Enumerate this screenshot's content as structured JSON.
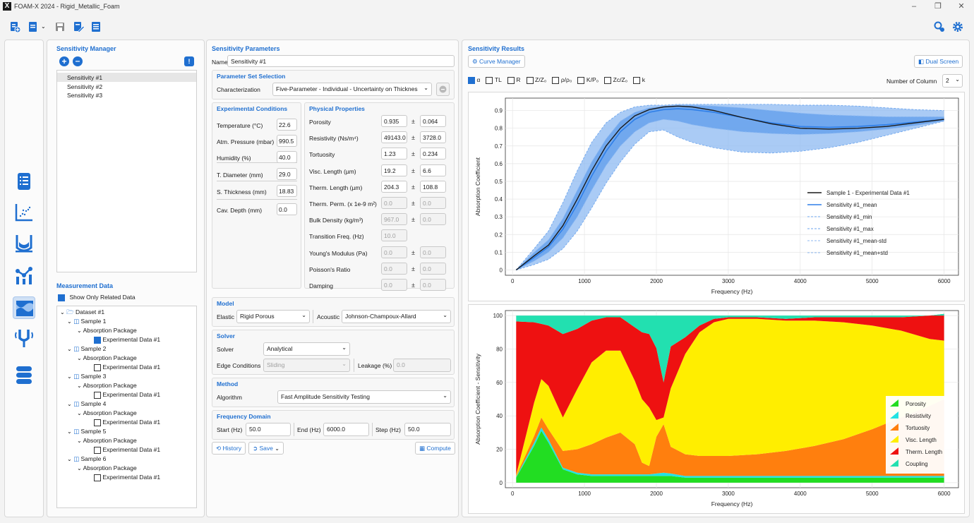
{
  "window": {
    "title": "FOAM-X 2024 - Rigid_Metallic_Foam",
    "logo": "X"
  },
  "sensitivity_manager": {
    "title": "Sensitivity Manager",
    "items": [
      "Sensitivity #1",
      "Sensitivity #2",
      "Sensitivity #3"
    ]
  },
  "measurement_data": {
    "title": "Measurement Data",
    "show_only_related": "Show Only Related Data",
    "dataset": "Dataset #1",
    "samples": [
      "Sample 1",
      "Sample 2",
      "Sample 3",
      "Sample 4",
      "Sample 5",
      "Sample 6"
    ],
    "package": "Absorption Package",
    "experimental": "Experimental Data #1"
  },
  "params": {
    "title": "Sensitivity Parameters",
    "name_label": "Name",
    "name_value": "Sensitivity #1",
    "param_set_title": "Parameter Set Selection",
    "characterization_label": "Characterization",
    "characterization_value": "Five-Parameter - Individual - Uncertainty on Thicknes",
    "exp_title": "Experimental Conditions",
    "exp": [
      {
        "label": "Temperature (°C)",
        "value": "22.6"
      },
      {
        "label": "Atm. Pressure (mbar)",
        "value": "990.5"
      },
      {
        "label": "Humidity (%)",
        "value": "40.0"
      },
      {
        "label": "T. Diameter (mm)",
        "value": "29.0"
      },
      {
        "label": "S. Thickness (mm)",
        "value": "18.83"
      },
      {
        "label": "Cav. Depth (mm)",
        "value": "0.0"
      }
    ],
    "phys_title": "Physical Properties",
    "pm": "±",
    "phys": [
      {
        "label": "Porosity",
        "value": "0.935",
        "unc": "0.064"
      },
      {
        "label": "Resistivity (Ns/m⁴)",
        "value": "49143.0",
        "unc": "3728.0"
      },
      {
        "label": "Tortuosity",
        "value": "1.23",
        "unc": "0.234"
      },
      {
        "label": "Visc. Length (µm)",
        "value": "19.2",
        "unc": "6.6"
      },
      {
        "label": "Therm. Length (µm)",
        "value": "204.3",
        "unc": "108.8"
      },
      {
        "label": "Therm. Perm. (x 1e-9 m²)",
        "value": "0.0",
        "unc": "0.0"
      },
      {
        "label": "Bulk Density (kg/m³)",
        "value": "967.0",
        "unc": "0.0"
      },
      {
        "label": "Transition Freq. (Hz)",
        "value": "10.0",
        "unc": ""
      },
      {
        "label": "Young's Modulus (Pa)",
        "value": "0.0",
        "unc": "0.0"
      },
      {
        "label": "Poisson's Ratio",
        "value": "0.0",
        "unc": "0.0"
      },
      {
        "label": "Damping",
        "value": "0.0",
        "unc": "0.0"
      }
    ],
    "model_title": "Model",
    "elastic_label": "Elastic",
    "elastic_value": "Rigid Porous",
    "acoustic_label": "Acoustic",
    "acoustic_value": "Johnson-Champoux-Allard",
    "solver_title": "Solver",
    "solver_label": "Solver",
    "solver_value": "Analytical",
    "edge_label": "Edge Conditions",
    "edge_value": "Sliding",
    "leakage_label": "Leakage (%)",
    "leakage_value": "0.0",
    "method_title": "Method",
    "algorithm_label": "Algorithm",
    "algorithm_value": "Fast Amplitude Sensitivity Testing",
    "freq_title": "Frequency Domain",
    "start_label": "Start (Hz)",
    "start_value": "50.0",
    "end_label": "End (Hz)",
    "end_value": "6000.0",
    "step_label": "Step (Hz)",
    "step_value": "50.0",
    "history": "History",
    "save": "Save",
    "compute": "Compute"
  },
  "results": {
    "title": "Sensitivity Results",
    "curve_manager": "Curve Manager",
    "dual_screen": "Dual Screen",
    "checks": [
      {
        "label": "α",
        "on": true
      },
      {
        "label": "TL",
        "on": false
      },
      {
        "label": "R",
        "on": false
      },
      {
        "label": "Z/Z₀",
        "on": false
      },
      {
        "label": "ρ/ρ₀",
        "on": false
      },
      {
        "label": "K/P₀",
        "on": false
      },
      {
        "label": "Zc/Z₀",
        "on": false
      },
      {
        "label": "k",
        "on": false
      }
    ],
    "num_col_label": "Number of Column",
    "num_col_value": "2"
  },
  "chart_data": [
    {
      "type": "line",
      "xlabel": "Frequency (Hz)",
      "ylabel": "Absorption Coefficient",
      "xlim": [
        -100,
        6200
      ],
      "ylim": [
        -0.03,
        0.97
      ],
      "xticks": [
        0,
        1000,
        2000,
        3000,
        4000,
        5000,
        6000
      ],
      "yticks": [
        0,
        0.1,
        0.2,
        0.3,
        0.4,
        0.5,
        0.6,
        0.7,
        0.8,
        0.9
      ],
      "x": [
        50,
        300,
        500,
        700,
        900,
        1100,
        1300,
        1500,
        1700,
        1900,
        2100,
        2300,
        2500,
        2800,
        3200,
        3600,
        4000,
        4400,
        4800,
        5200,
        5600,
        6000
      ],
      "series": [
        {
          "name": "Sample 1 - Experimental Data #1",
          "color": "#1a1a1a",
          "values": [
            0.0,
            0.08,
            0.14,
            0.25,
            0.4,
            0.56,
            0.7,
            0.8,
            0.87,
            0.905,
            0.92,
            0.925,
            0.92,
            0.9,
            0.86,
            0.825,
            0.8,
            0.795,
            0.8,
            0.81,
            0.83,
            0.85
          ]
        },
        {
          "name": "Sensitivity #1_mean",
          "color": "#2f7fe8",
          "values": [
            0.0,
            0.07,
            0.13,
            0.23,
            0.37,
            0.53,
            0.67,
            0.78,
            0.85,
            0.89,
            0.905,
            0.91,
            0.905,
            0.89,
            0.86,
            0.83,
            0.81,
            0.805,
            0.81,
            0.82,
            0.835,
            0.85
          ]
        },
        {
          "name": "Sensitivity #1_min",
          "color": "#6ea6ee",
          "values": [
            0.0,
            0.03,
            0.06,
            0.12,
            0.22,
            0.35,
            0.49,
            0.61,
            0.71,
            0.78,
            0.79,
            0.75,
            0.72,
            0.69,
            0.665,
            0.66,
            0.67,
            0.69,
            0.72,
            0.76,
            0.8,
            0.84
          ]
        },
        {
          "name": "Sensitivity #1_max",
          "color": "#6ea6ee",
          "values": [
            0.0,
            0.12,
            0.22,
            0.38,
            0.56,
            0.72,
            0.83,
            0.89,
            0.92,
            0.93,
            0.93,
            0.935,
            0.935,
            0.935,
            0.935,
            0.935,
            0.93,
            0.93,
            0.925,
            0.915,
            0.905,
            0.9
          ]
        },
        {
          "name": "Sensitivity #1_mean-std",
          "color": "#8fbaf2",
          "values": [
            0.0,
            0.05,
            0.1,
            0.18,
            0.3,
            0.45,
            0.59,
            0.7,
            0.78,
            0.83,
            0.85,
            0.84,
            0.82,
            0.8,
            0.78,
            0.77,
            0.765,
            0.77,
            0.78,
            0.795,
            0.815,
            0.84
          ]
        },
        {
          "name": "Sensitivity #1_mean+std",
          "color": "#8fbaf2",
          "values": [
            0.0,
            0.1,
            0.17,
            0.29,
            0.45,
            0.61,
            0.74,
            0.84,
            0.89,
            0.915,
            0.925,
            0.93,
            0.93,
            0.925,
            0.915,
            0.9,
            0.885,
            0.875,
            0.87,
            0.865,
            0.865,
            0.865
          ]
        }
      ]
    },
    {
      "type": "area",
      "stacked": true,
      "xlabel": "Frequency (Hz)",
      "ylabel": "Absorption Coefficient - Sensitivity",
      "xlim": [
        -100,
        6200
      ],
      "ylim": [
        -3,
        103
      ],
      "xticks": [
        0,
        1000,
        2000,
        3000,
        4000,
        5000,
        6000
      ],
      "yticks": [
        0,
        20,
        40,
        60,
        80,
        100
      ],
      "x": [
        50,
        300,
        400,
        500,
        700,
        900,
        1100,
        1300,
        1500,
        1700,
        1800,
        1900,
        2000,
        2100,
        2200,
        2400,
        2600,
        2800,
        3000,
        3400,
        3800,
        4200,
        4600,
        5000,
        5400,
        5800,
        6000
      ],
      "series": [
        {
          "name": "Porosity",
          "color": "#22dd22",
          "values": [
            3,
            22,
            31,
            24,
            8,
            5,
            4,
            4,
            4,
            4,
            4,
            4,
            4,
            4,
            4,
            3,
            3,
            3,
            3,
            3,
            3,
            3,
            3,
            3,
            3,
            3,
            3
          ]
        },
        {
          "name": "Resistivity",
          "color": "#22e3e3",
          "values": [
            0.5,
            2,
            2,
            2,
            1,
            1,
            1,
            1,
            1,
            1,
            1,
            1,
            1.5,
            2,
            1.5,
            1,
            1,
            1,
            1,
            1,
            1,
            1,
            1,
            1,
            1,
            1,
            1
          ]
        },
        {
          "name": "Tortuosity",
          "color": "#ff7f0e",
          "values": [
            0.5,
            4,
            6,
            6,
            10,
            14,
            18,
            22,
            25,
            18,
            7,
            5,
            22,
            29,
            16,
            13,
            12,
            12,
            12,
            13,
            15,
            18,
            22,
            28,
            35,
            42,
            46
          ]
        },
        {
          "name": "Visc. Length",
          "color": "#ffee00",
          "values": [
            0.5,
            20,
            23,
            26,
            20,
            36,
            49,
            52,
            49,
            38,
            38,
            35,
            10,
            4,
            35,
            60,
            74,
            80,
            82,
            81,
            78,
            75,
            70,
            62,
            52,
            40,
            35
          ]
        },
        {
          "name": "Therm. Length",
          "color": "#ee1111",
          "values": [
            92,
            48,
            33,
            36,
            50,
            36,
            25,
            20,
            20,
            32,
            40,
            44,
            43,
            21,
            25,
            10,
            4,
            2,
            1,
            1,
            1,
            2,
            3,
            5,
            8,
            14,
            16
          ]
        },
        {
          "name": "Coupling",
          "color": "#22e0b0",
          "values": [
            3.5,
            4,
            5,
            6,
            11,
            8,
            3,
            1,
            1,
            7,
            10,
            11,
            19.5,
            40,
            18.5,
            13,
            6,
            2,
            1,
            1,
            2,
            1,
            1,
            1,
            1,
            0,
            -1
          ]
        }
      ]
    }
  ]
}
